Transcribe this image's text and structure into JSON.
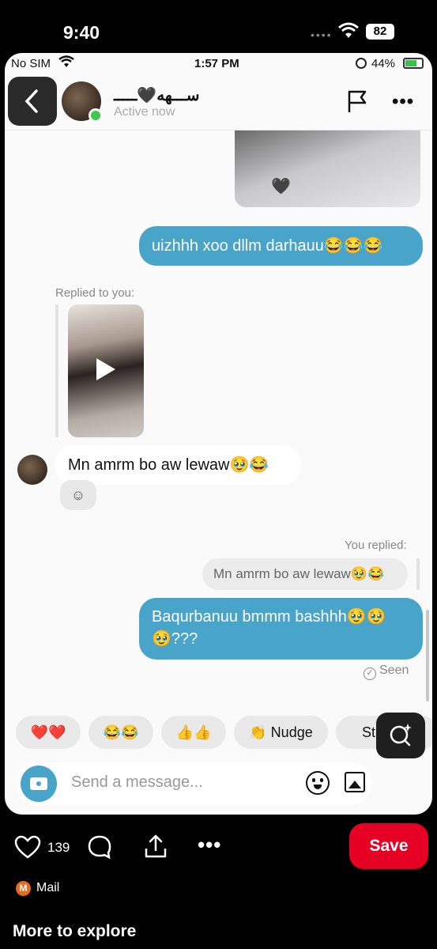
{
  "device": {
    "time": "9:40",
    "battery": "82"
  },
  "inner_status": {
    "carrier": "No SIM",
    "time": "1:57 PM",
    "battery": "44%"
  },
  "chat_header": {
    "name": "ســـهه🖤ـــــ",
    "status": "Active now"
  },
  "messages": {
    "sent_1": "uizhhh xoo dllm darhauu😂😂😂",
    "replied_label": "Replied to you:",
    "received_1": "Mn amrm bo aw lewaw🥹😂",
    "you_replied_label": "You replied:",
    "quoted": "Mn amrm bo aw lewaw🥹😂",
    "sent_2": "Baqurbanuu bmmm bashhh🥹🥹🥹???",
    "seen": "Seen"
  },
  "quick_replies": [
    {
      "label": "❤️❤️"
    },
    {
      "label": "😂😂"
    },
    {
      "label": "👍👍"
    },
    {
      "label": "👏 Nudge"
    },
    {
      "label": "Stickers"
    }
  ],
  "composer": {
    "placeholder": "Send a message..."
  },
  "pin_actions": {
    "likes": "139",
    "save": "Save"
  },
  "source": {
    "icon": "M",
    "name": "Mail"
  },
  "section": {
    "title": "More to explore"
  },
  "colors": {
    "accent": "#48a4c9",
    "save": "#e60023",
    "online": "#3cc94f"
  }
}
